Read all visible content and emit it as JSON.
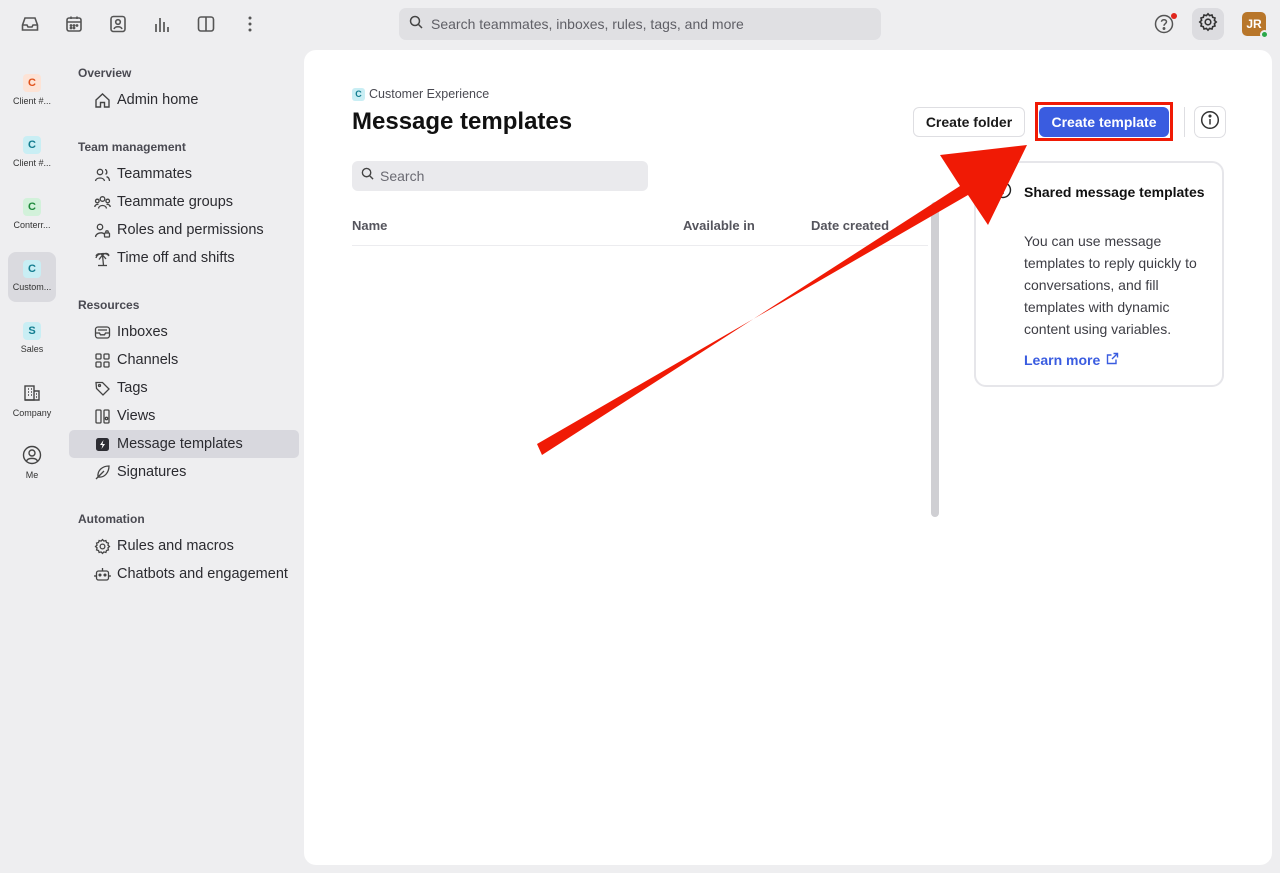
{
  "topbar": {
    "search_placeholder": "Search teammates, inboxes, rules, tags, and more",
    "avatar_initials": "JR",
    "icons": [
      "inbox-icon",
      "calendar-icon",
      "contacts-icon",
      "analytics-icon",
      "split-view-icon",
      "more-icon",
      "help-icon",
      "settings-icon"
    ]
  },
  "rail": [
    {
      "badge": "C",
      "label": "Client #...",
      "color": "#e0521b",
      "bg": "#fde3d6"
    },
    {
      "badge": "C",
      "label": "Client #...",
      "color": "#127c8f",
      "bg": "#c9eef4"
    },
    {
      "badge": "C",
      "label": "Conterr...",
      "color": "#1f8a3c",
      "bg": "#d2f1da"
    },
    {
      "badge": "C",
      "label": "Custom...",
      "color": "#127c8f",
      "bg": "#c9eef4"
    },
    {
      "badge": "S",
      "label": "Sales",
      "color": "#127c8f",
      "bg": "#c9eef4"
    },
    {
      "label": "Company"
    },
    {
      "label": "Me"
    }
  ],
  "nav": {
    "overview": {
      "title": "Overview",
      "items": [
        "Admin home"
      ]
    },
    "team": {
      "title": "Team management",
      "items": [
        "Teammates",
        "Teammate groups",
        "Roles and permissions",
        "Time off and shifts"
      ]
    },
    "resources": {
      "title": "Resources",
      "items": [
        "Inboxes",
        "Channels",
        "Tags",
        "Views",
        "Message templates",
        "Signatures"
      ]
    },
    "automation": {
      "title": "Automation",
      "items": [
        "Rules and macros",
        "Chatbots and engagement"
      ]
    }
  },
  "main": {
    "breadcrumb_badge": "C",
    "breadcrumb": "Customer Experience",
    "title": "Message templates",
    "create_folder": "Create folder",
    "create_template": "Create template",
    "search_placeholder": "Search",
    "columns": [
      "Name",
      "Available in",
      "Date created"
    ]
  },
  "info_card": {
    "title": "Shared message templates",
    "text": "You can use message templates to reply quickly to conversations, and fill templates with dynamic content using variables.",
    "link": "Learn more"
  },
  "colors": {
    "accent": "#3a5ce0",
    "annotation": "#f01a05"
  }
}
